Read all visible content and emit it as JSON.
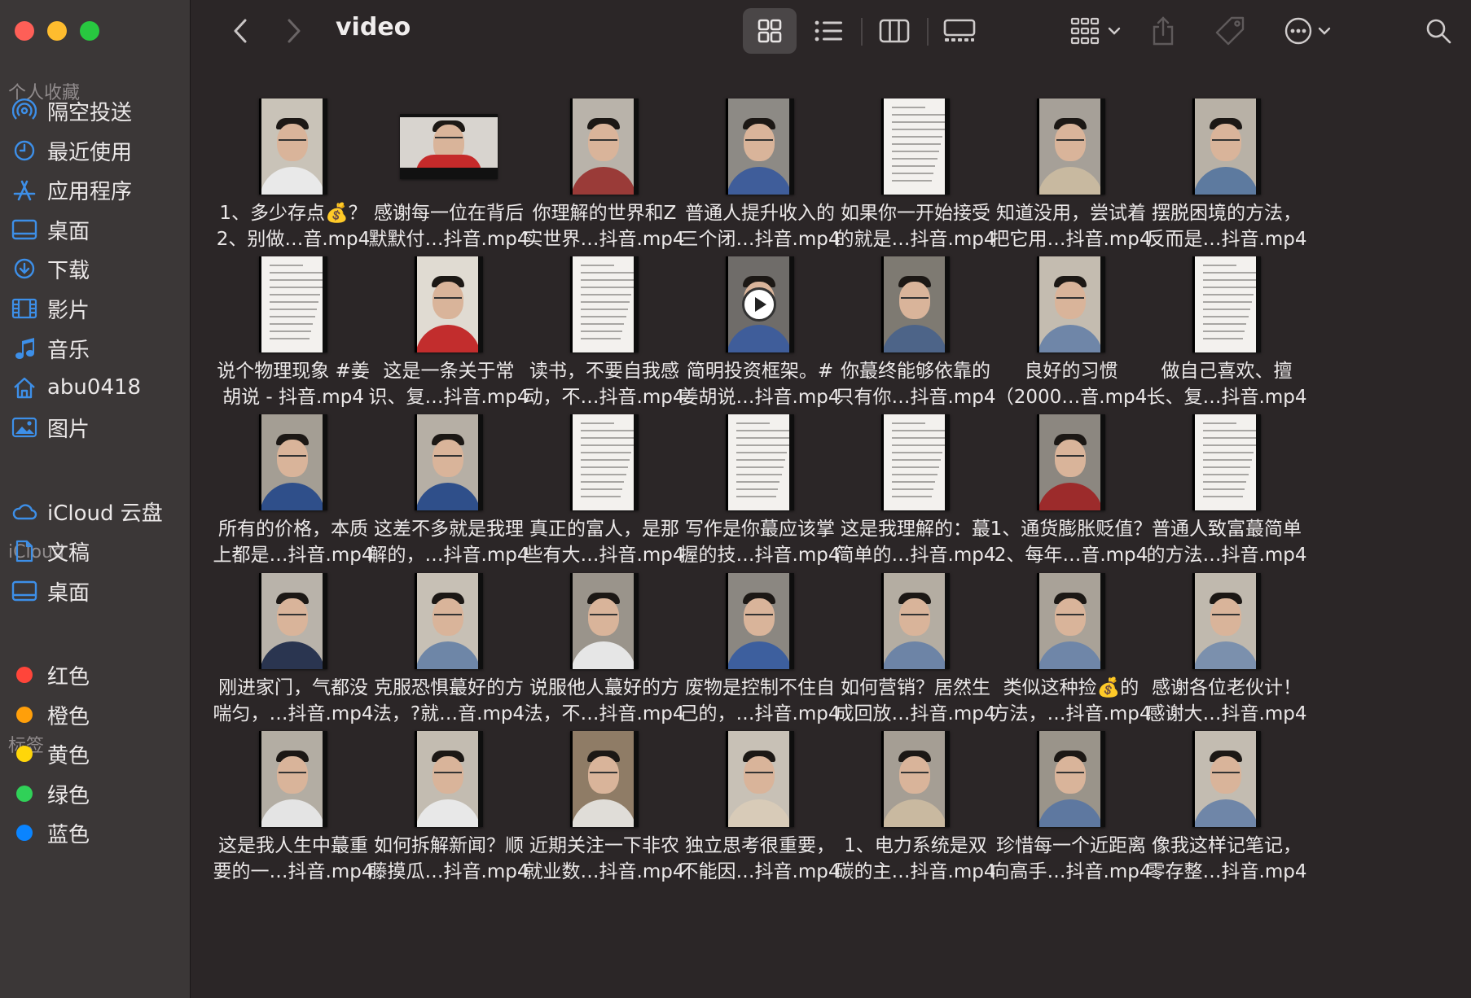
{
  "window": {
    "title": "video"
  },
  "sidebar": {
    "favorites_header": "个人收藏",
    "favorites": [
      {
        "label": "隔空投送",
        "icon": "airdrop-icon"
      },
      {
        "label": "最近使用",
        "icon": "clock-icon"
      },
      {
        "label": "应用程序",
        "icon": "applications-icon"
      },
      {
        "label": "桌面",
        "icon": "desktop-icon"
      },
      {
        "label": "下载",
        "icon": "download-icon"
      },
      {
        "label": "影片",
        "icon": "film-icon"
      },
      {
        "label": "音乐",
        "icon": "music-icon"
      },
      {
        "label": "abu0418",
        "icon": "home-icon"
      },
      {
        "label": "图片",
        "icon": "photos-icon"
      }
    ],
    "icloud_header": "iCloud",
    "icloud": [
      {
        "label": "iCloud 云盘",
        "icon": "cloud-icon"
      },
      {
        "label": "文稿",
        "icon": "document-icon"
      },
      {
        "label": "桌面",
        "icon": "desktop-icon"
      }
    ],
    "tags_header": "标签",
    "tags": [
      {
        "label": "红色",
        "color": "#ff453a"
      },
      {
        "label": "橙色",
        "color": "#ff9f0a"
      },
      {
        "label": "黄色",
        "color": "#ffd60a"
      },
      {
        "label": "绿色",
        "color": "#30d158"
      },
      {
        "label": "蓝色",
        "color": "#0a84ff"
      }
    ]
  },
  "toolbar": {
    "view_modes": [
      "grid-view-icon",
      "list-view-icon",
      "column-view-icon",
      "gallery-view-icon"
    ],
    "active_view": "grid-view-icon"
  },
  "files": [
    {
      "l1": "1、多少存点💰？",
      "l2": "2、别做…音.mp4",
      "kind": "person",
      "shirt": "#e9e9e9",
      "bg": "#c9c3b8"
    },
    {
      "l1": "感谢每一位在背后",
      "l2": "默默付…抖音.mp4",
      "kind": "wide",
      "shirt": "#c52a2a",
      "bg": "#d8d4cf"
    },
    {
      "l1": "你理解的世界和Z",
      "l2": "实世界…抖音.mp4",
      "kind": "person",
      "shirt": "#9a3b38",
      "bg": "#b9b3aa"
    },
    {
      "l1": "普通人提升收入的",
      "l2": "三个闭…抖音.mp4",
      "kind": "person",
      "shirt": "#3f5d9a",
      "bg": "#8d8a85"
    },
    {
      "l1": "如果你一开始接受",
      "l2": "的就是…抖音.mp4",
      "kind": "doc"
    },
    {
      "l1": "知道没用，尝试着",
      "l2": "把它用…抖音.mp4",
      "kind": "person",
      "shirt": "#c8b9a0",
      "bg": "#a6a098"
    },
    {
      "l1": "摆脱困境的方法，",
      "l2": "反而是…抖音.mp4",
      "kind": "person",
      "shirt": "#5d7a9f",
      "bg": "#b8b1a6"
    },
    {
      "l1": "说个物理现象 #姜",
      "l2": "胡说 - 抖音.mp4",
      "kind": "doc"
    },
    {
      "l1": "这是一条关于常",
      "l2": "识、复…抖音.mp4",
      "kind": "person",
      "shirt": "#c22d2d",
      "bg": "#e0dbd2"
    },
    {
      "l1": "读书，不要自我感",
      "l2": "动，不…抖音.mp4",
      "kind": "doc"
    },
    {
      "l1": "简明投资框架。#",
      "l2": "姜胡说…抖音.mp4",
      "kind": "play",
      "shirt": "#3f5d9a",
      "bg": "#6f6c69"
    },
    {
      "l1": "你蕞终能够依靠的",
      "l2": "只有你…抖音.mp4",
      "kind": "person",
      "shirt": "#4d6488",
      "bg": "#7e7a72"
    },
    {
      "l1": "良好的习惯",
      "l2": "（2000…音.mp4",
      "kind": "person",
      "shirt": "#6f86a8",
      "bg": "#c4bcb0"
    },
    {
      "l1": "做自己喜欢、擅",
      "l2": "长、复…抖音.mp4",
      "kind": "doc"
    },
    {
      "l1": "所有的价格，本质",
      "l2": "上都是…抖音.mp4",
      "kind": "person",
      "shirt": "#2f4f8a",
      "bg": "#a49e94"
    },
    {
      "l1": "这差不多就是我理",
      "l2": "解的，…抖音.mp4",
      "kind": "person",
      "shirt": "#2f4f8a",
      "bg": "#b6afa5"
    },
    {
      "l1": "真正的富人，是那",
      "l2": "些有大…抖音.mp4",
      "kind": "doc"
    },
    {
      "l1": "写作是你蕞应该掌",
      "l2": "握的技…抖音.mp4",
      "kind": "doc"
    },
    {
      "l1": "这是我理解的：蕞",
      "l2": "简单的…抖音.mp4",
      "kind": "doc"
    },
    {
      "l1": "1、通货膨胀贬值？",
      "l2": "2、每年…音.mp4",
      "kind": "person",
      "shirt": "#9c2b2b",
      "bg": "#8c8780"
    },
    {
      "l1": "普通人致富蕞简单",
      "l2": "的方法…抖音.mp4",
      "kind": "doc"
    },
    {
      "l1": "刚进家门，气都没",
      "l2": "喘匀，…抖音.mp4",
      "kind": "person",
      "shirt": "#2a3550",
      "bg": "#b9b3aa"
    },
    {
      "l1": "克服恐惧蕞好的方",
      "l2": "法，?就…音.mp4",
      "kind": "person",
      "shirt": "#6e86a7",
      "bg": "#c7c0b5"
    },
    {
      "l1": "说服他人蕞好的方",
      "l2": "法，不…抖音.mp4",
      "kind": "person",
      "shirt": "#e6e6e6",
      "bg": "#9a948b"
    },
    {
      "l1": "废物是控制不住自",
      "l2": "己的，…抖音.mp4",
      "kind": "person",
      "shirt": "#3d5f9e",
      "bg": "#8b8781"
    },
    {
      "l1": "如何营销？居然生",
      "l2": "成回放…抖音.mp4",
      "kind": "person",
      "shirt": "#6d84a6",
      "bg": "#b4ada2"
    },
    {
      "l1": "类似这种捡💰的",
      "l2": "方法，…抖音.mp4",
      "kind": "person",
      "shirt": "#6f86a8",
      "bg": "#a9a298"
    },
    {
      "l1": "感谢各位老伙计！",
      "l2": "感谢大…抖音.mp4",
      "kind": "person",
      "shirt": "#7b90ad",
      "bg": "#c0b9ae"
    },
    {
      "l1": "这是我人生中蕞重",
      "l2": "要的一…抖音.mp4",
      "kind": "person",
      "shirt": "#e4e4e4",
      "bg": "#b3ada3"
    },
    {
      "l1": "如何拆解新闻？顺",
      "l2": "藤摸瓜…抖音.mp4",
      "kind": "person",
      "shirt": "#e8e8e8",
      "bg": "#c3bcb1"
    },
    {
      "l1": "近期关注一下非农",
      "l2": "就业数…抖音.mp4",
      "kind": "person",
      "shirt": "#e0ddd8",
      "bg": "#8f7c66"
    },
    {
      "l1": "独立思考很重要，",
      "l2": "不能因…抖音.mp4",
      "kind": "person",
      "shirt": "#d8cbb8",
      "bg": "#c8c1b6"
    },
    {
      "l1": "1、电力系统是双",
      "l2": "碳的主…抖音.mp4",
      "kind": "person",
      "shirt": "#c9b9a0",
      "bg": "#a59e94"
    },
    {
      "l1": "珍惜每一个近距离",
      "l2": "向高手…抖音.mp4",
      "kind": "person",
      "shirt": "#5e78a0",
      "bg": "#9a948a"
    },
    {
      "l1": "像我这样记笔记，",
      "l2": "零存整…抖音.mp4",
      "kind": "person",
      "shirt": "#6f86a8",
      "bg": "#c3bcb1"
    }
  ]
}
